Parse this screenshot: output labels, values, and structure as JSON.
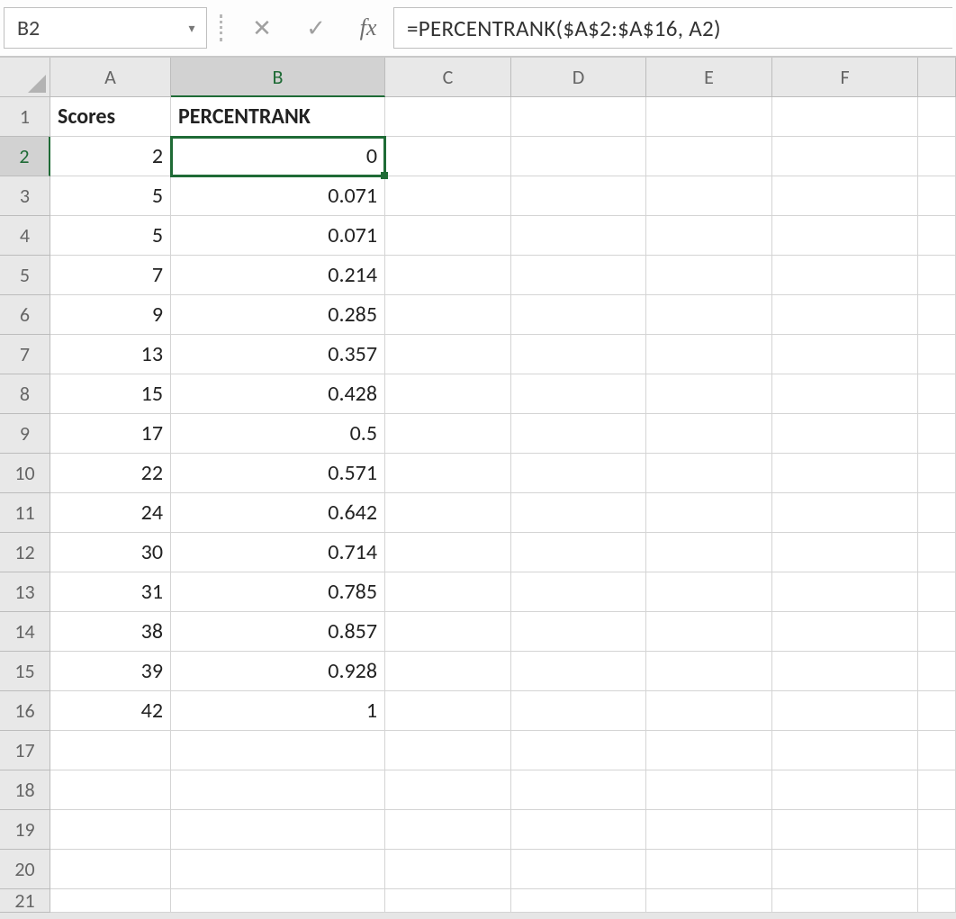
{
  "formula_bar": {
    "cell_ref": "B2",
    "fx_label": "fx",
    "formula": "=PERCENTRANK($A$2:$A$16, A2)",
    "cancel_glyph": "✕",
    "accept_glyph": "✓",
    "dropdown_glyph": "▾"
  },
  "columns": [
    "A",
    "B",
    "C",
    "D",
    "E",
    "F",
    ""
  ],
  "headers": {
    "A": "Scores",
    "B": "PERCENTRANK"
  },
  "active_cell": "B2",
  "rows": [
    {
      "n": 1,
      "A": "Scores",
      "B": "PERCENTRANK"
    },
    {
      "n": 2,
      "A": "2",
      "B": "0"
    },
    {
      "n": 3,
      "A": "5",
      "B": "0.071"
    },
    {
      "n": 4,
      "A": "5",
      "B": "0.071"
    },
    {
      "n": 5,
      "A": "7",
      "B": "0.214"
    },
    {
      "n": 6,
      "A": "9",
      "B": "0.285"
    },
    {
      "n": 7,
      "A": "13",
      "B": "0.357"
    },
    {
      "n": 8,
      "A": "15",
      "B": "0.428"
    },
    {
      "n": 9,
      "A": "17",
      "B": "0.5"
    },
    {
      "n": 10,
      "A": "22",
      "B": "0.571"
    },
    {
      "n": 11,
      "A": "24",
      "B": "0.642"
    },
    {
      "n": 12,
      "A": "30",
      "B": "0.714"
    },
    {
      "n": 13,
      "A": "31",
      "B": "0.785"
    },
    {
      "n": 14,
      "A": "38",
      "B": "0.857"
    },
    {
      "n": 15,
      "A": "39",
      "B": "0.928"
    },
    {
      "n": 16,
      "A": "42",
      "B": "1"
    },
    {
      "n": 17,
      "A": "",
      "B": ""
    },
    {
      "n": 18,
      "A": "",
      "B": ""
    },
    {
      "n": 19,
      "A": "",
      "B": ""
    },
    {
      "n": 20,
      "A": "",
      "B": ""
    },
    {
      "n": 21,
      "A": "",
      "B": ""
    }
  ],
  "chart_data": {
    "type": "table",
    "columns": [
      "Scores",
      "PERCENTRANK"
    ],
    "data": [
      [
        2,
        0
      ],
      [
        5,
        0.071
      ],
      [
        5,
        0.071
      ],
      [
        7,
        0.214
      ],
      [
        9,
        0.285
      ],
      [
        13,
        0.357
      ],
      [
        15,
        0.428
      ],
      [
        17,
        0.5
      ],
      [
        22,
        0.571
      ],
      [
        24,
        0.642
      ],
      [
        30,
        0.714
      ],
      [
        31,
        0.785
      ],
      [
        38,
        0.857
      ],
      [
        39,
        0.928
      ],
      [
        42,
        1
      ]
    ]
  }
}
